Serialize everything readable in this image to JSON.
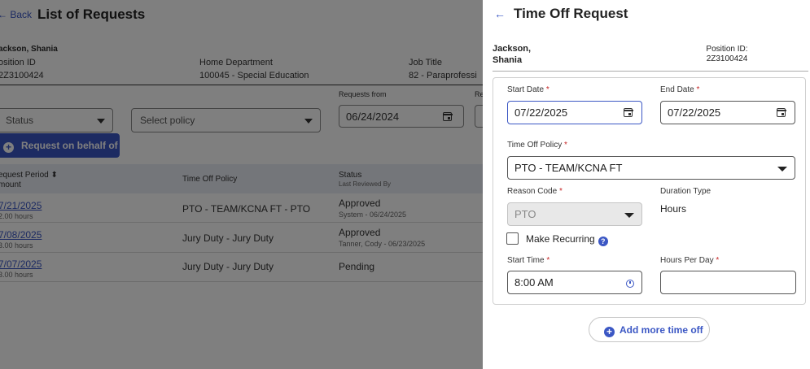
{
  "page": {
    "back_label": "← Back",
    "title": "List of Requests",
    "employee_name": "ackson, Shania",
    "position_id_label": "osition ID",
    "position_id_value": "2Z3100424",
    "home_dept_label": "Home Department",
    "home_dept_value": "100045 - Special Education",
    "job_title_label": "Job Title",
    "job_title_value": "82 - Paraprofessi",
    "requests_from_label": "Requests from",
    "requests_from_value": "06/24/2024",
    "re_label": "Re",
    "status_placeholder": "Status",
    "policy_placeholder": "Select policy",
    "behalf_button": "Request on behalf of",
    "table": {
      "headers": {
        "period": "equest Period",
        "amount": "mount",
        "policy": "Time Off Policy",
        "status": "Status",
        "reviewed_by": "Last Reviewed By"
      },
      "rows": [
        {
          "date": "7/21/2025",
          "hours": "2.00 hours",
          "policy": "PTO - TEAM/KCNA FT - PTO",
          "status": "Approved",
          "reviewer": "System - 06/24/2025"
        },
        {
          "date": "7/08/2025",
          "hours": "3.00 hours",
          "policy": "Jury Duty - Jury Duty",
          "status": "Approved",
          "reviewer": "Tanner, Cody - 06/23/2025"
        },
        {
          "date": "7/07/2025",
          "hours": "3.00 hours",
          "policy": "Jury Duty - Jury Duty",
          "status": "Pending",
          "reviewer": ""
        }
      ]
    }
  },
  "panel": {
    "back_arrow": "←",
    "title": "Time Off Request",
    "employee_name": "Jackson,\nShania",
    "position_label": "Position ID:",
    "position_value": "2Z3100424",
    "start_date_label": "Start Date",
    "start_date_value": "07/22/2025",
    "end_date_label": "End Date",
    "end_date_value": "07/22/2025",
    "policy_label": "Time Off Policy",
    "policy_value": "PTO - TEAM/KCNA FT",
    "reason_label": "Reason Code",
    "reason_value": "PTO",
    "duration_label": "Duration Type",
    "duration_value": "Hours",
    "recurring_label": "Make Recurring",
    "start_time_label": "Start Time",
    "start_time_value": "8:00 AM",
    "hours_per_day_label": "Hours Per Day",
    "hours_per_day_value": "",
    "required_mark": "*",
    "help_glyph": "?",
    "add_more_label": "Add more time off"
  },
  "colors": {
    "accent": "#3b57c4",
    "required": "#c62828",
    "overlay": "rgba(0,0,0,0.5)"
  },
  "icons": [
    "arrow-left-icon",
    "calendar-icon",
    "chevron-down-icon",
    "plus-circle-icon",
    "clock-icon",
    "help-icon",
    "sort-icon"
  ]
}
